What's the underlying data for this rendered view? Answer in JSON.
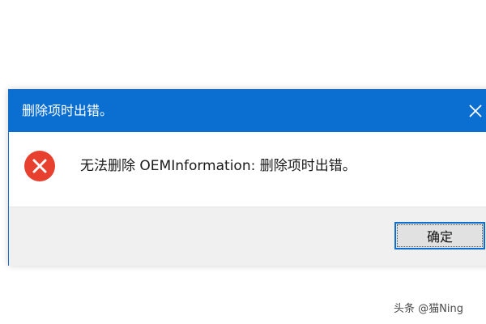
{
  "dialog": {
    "title": "删除项时出错。",
    "message": "无法删除 OEMInformation: 删除项时出错。",
    "ok_label": "确定",
    "close_icon": "close-icon",
    "error_icon": "error-icon"
  },
  "watermark": {
    "text": "头条 @猫Ning"
  },
  "colors": {
    "titlebar": "#0a6fd1",
    "error_red": "#e8402f",
    "footer_bg": "#f0f0f0"
  }
}
